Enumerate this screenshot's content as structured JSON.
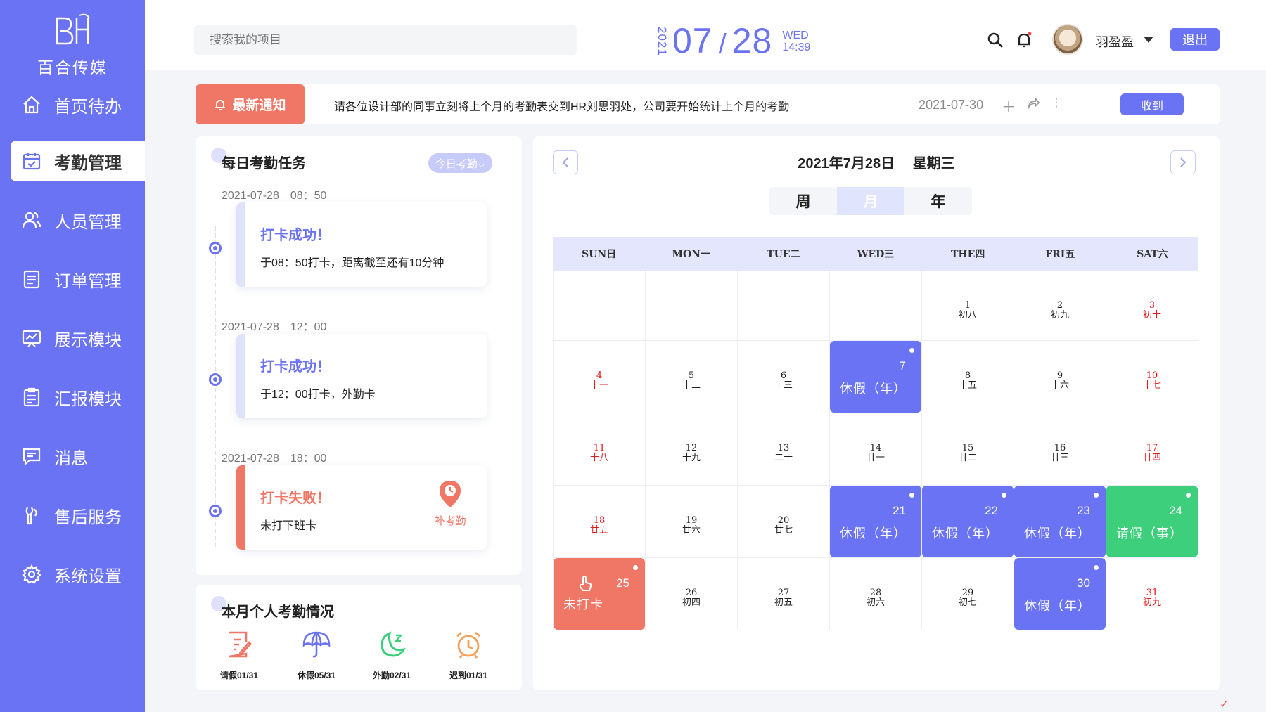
{
  "app": {
    "logo_text": "百合传媒",
    "logo_mark": "BH"
  },
  "sidebar": {
    "items": [
      {
        "label": "首页待办",
        "icon": "home-icon"
      },
      {
        "label": "考勤管理",
        "icon": "calendar-check-icon",
        "active": true
      },
      {
        "label": "人员管理",
        "icon": "users-icon"
      },
      {
        "label": "订单管理",
        "icon": "list-icon"
      },
      {
        "label": "展示模块",
        "icon": "presentation-icon"
      },
      {
        "label": "汇报模块",
        "icon": "report-icon"
      },
      {
        "label": "消息",
        "icon": "message-icon"
      },
      {
        "label": "售后服务",
        "icon": "service-icon"
      },
      {
        "label": "系统设置",
        "icon": "gear-icon"
      }
    ]
  },
  "header": {
    "search_placeholder": "搜索我的项目",
    "year": "2021",
    "month": "07",
    "day": "28",
    "weekday": "WED",
    "time": "14:39",
    "user_name": "羽盈盈",
    "logout_label": "退出"
  },
  "notice": {
    "button_label": "最新通知",
    "text": "请各位设计部的同事立刻将上个月的考勤表交到HR刘思羽处，公司要开始统计上个月的考勤",
    "date": "2021-07-30",
    "receive_label": "收到"
  },
  "tasks": {
    "title": "每日考勤任务",
    "filter_label": "今日考勤",
    "items": [
      {
        "time": "2021-07-28　08：50",
        "status": "打卡成功！",
        "desc": "于08：50打卡，距离截至还有10分钟",
        "failed": false
      },
      {
        "time": "2021-07-28　12：00",
        "status": "打卡成功！",
        "desc": "于12：00打卡，外勤卡",
        "failed": false
      },
      {
        "time": "2021-07-28　18：00",
        "status": "打卡失败！",
        "desc": "未打下班卡",
        "failed": true,
        "action": "补考勤"
      }
    ]
  },
  "monthly": {
    "title": "本月个人考勤情况",
    "stats": [
      {
        "label": "请假01/31",
        "icon": "leave-form-icon",
        "color": "#f07766"
      },
      {
        "label": "休假05/31",
        "icon": "umbrella-icon",
        "color": "#6b73f5"
      },
      {
        "label": "外勤02/31",
        "icon": "moon-icon",
        "color": "#3ecf7d"
      },
      {
        "label": "迟到01/31",
        "icon": "alarm-clock-icon",
        "color": "#f5a05a"
      }
    ]
  },
  "calendar": {
    "title_date": "2021年7月28日",
    "title_weekday": "星期三",
    "views": [
      "周",
      "月",
      "年"
    ],
    "active_view": "月",
    "weekdays": [
      "SUN日",
      "MON一",
      "TUE二",
      "WED三",
      "THE四",
      "FRI五",
      "SAT六"
    ],
    "weeks": [
      [
        null,
        null,
        null,
        null,
        {
          "d": "1",
          "l": "初八"
        },
        {
          "d": "2",
          "l": "初九"
        },
        {
          "d": "3",
          "l": "初十",
          "red": true
        }
      ],
      [
        {
          "d": "4",
          "l": "十一",
          "red": true
        },
        {
          "d": "5",
          "l": "十二"
        },
        {
          "d": "6",
          "l": "十三"
        },
        {
          "d": "7",
          "event": "休假（年）",
          "type": "leave"
        },
        {
          "d": "8",
          "l": "十五"
        },
        {
          "d": "9",
          "l": "十六"
        },
        {
          "d": "10",
          "l": "十七",
          "red": true
        }
      ],
      [
        {
          "d": "11",
          "l": "十八",
          "red": true
        },
        {
          "d": "12",
          "l": "十九"
        },
        {
          "d": "13",
          "l": "二十"
        },
        {
          "d": "14",
          "l": "廿一"
        },
        {
          "d": "15",
          "l": "廿二"
        },
        {
          "d": "16",
          "l": "廿三"
        },
        {
          "d": "17",
          "l": "廿四",
          "red": true
        }
      ],
      [
        {
          "d": "18",
          "l": "廿五",
          "red": true
        },
        {
          "d": "19",
          "l": "廿六"
        },
        {
          "d": "20",
          "l": "廿七"
        },
        {
          "d": "21",
          "event": "休假（年）",
          "type": "leave"
        },
        {
          "d": "22",
          "event": "休假（年）",
          "type": "leave"
        },
        {
          "d": "23",
          "event": "休假（年）",
          "type": "leave"
        },
        {
          "d": "24",
          "event": "请假（事）",
          "type": "personal"
        }
      ],
      [
        {
          "d": "25",
          "event": "未打卡",
          "type": "miss"
        },
        {
          "d": "26",
          "l": "初四"
        },
        {
          "d": "27",
          "l": "初五"
        },
        {
          "d": "28",
          "l": "初六"
        },
        {
          "d": "29",
          "l": "初七"
        },
        {
          "d": "30",
          "event": "休假（年）",
          "type": "leave"
        },
        {
          "d": "31",
          "l": "初九",
          "red": true
        }
      ]
    ]
  },
  "colors": {
    "primary": "#6b73f5",
    "danger": "#f07766",
    "success": "#3ecf7d",
    "weekend": "#e11b1b"
  }
}
